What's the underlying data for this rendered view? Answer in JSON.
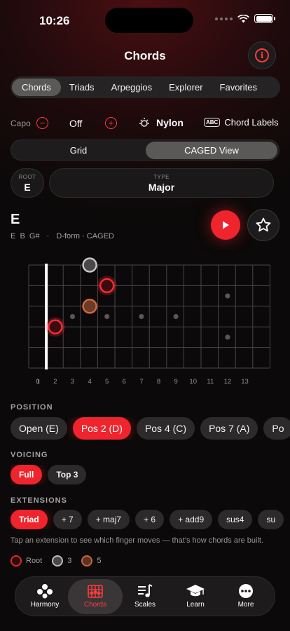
{
  "status": {
    "time": "10:26"
  },
  "header": {
    "title": "Chords"
  },
  "tabs": [
    {
      "label": "Chords"
    },
    {
      "label": "Triads"
    },
    {
      "label": "Arpeggios"
    },
    {
      "label": "Explorer"
    },
    {
      "label": "Favorites"
    }
  ],
  "capo": {
    "label": "Capo",
    "value": "Off",
    "minus_icon": "minus-circle-icon",
    "plus_icon": "plus-circle-icon"
  },
  "tone": {
    "label": "Nylon",
    "icon": "sun-icon"
  },
  "chord_labels": {
    "badge": "ABC",
    "label": "Chord Labels"
  },
  "view_toggle": {
    "grid": "Grid",
    "caged": "CAGED View",
    "selected": "CAGED View"
  },
  "root": {
    "caption": "ROOT",
    "value": "E"
  },
  "type": {
    "caption": "TYPE",
    "value": "Major"
  },
  "chord": {
    "name": "E",
    "notes": "E  B  G#",
    "sep": "·",
    "shape": "D-form · CAGED"
  },
  "fretboard": {
    "fret_numbers": [
      "0",
      "1",
      "2",
      "3",
      "4",
      "5",
      "6",
      "7",
      "8",
      "9",
      "10",
      "11",
      "12",
      "13"
    ],
    "inlays_single": [
      3,
      5,
      7,
      9
    ],
    "inlays_double": [
      12
    ],
    "notes": [
      {
        "string": 1,
        "fret": 4,
        "role": "third"
      },
      {
        "string": 2,
        "fret": 5,
        "role": "root"
      },
      {
        "string": 3,
        "fret": 4,
        "role": "fifth"
      },
      {
        "string": 4,
        "fret": 2,
        "role": "root"
      }
    ]
  },
  "position": {
    "label": "POSITION",
    "options": [
      {
        "label": "Open (E)",
        "active": false
      },
      {
        "label": "Pos 2 (D)",
        "active": true
      },
      {
        "label": "Pos 4 (C)",
        "active": false
      },
      {
        "label": "Pos 7 (A)",
        "active": false
      },
      {
        "label": "Po",
        "active": false
      }
    ]
  },
  "voicing": {
    "label": "VOICING",
    "options": [
      {
        "label": "Full",
        "active": true
      },
      {
        "label": "Top 3",
        "active": false
      }
    ]
  },
  "extensions": {
    "label": "EXTENSIONS",
    "options": [
      {
        "label": "Triad",
        "active": true
      },
      {
        "label": "+ 7",
        "active": false
      },
      {
        "label": "+ maj7",
        "active": false
      },
      {
        "label": "+ 6",
        "active": false
      },
      {
        "label": "+ add9",
        "active": false
      },
      {
        "label": "sus4",
        "active": false
      },
      {
        "label": "su",
        "active": false
      }
    ],
    "hint": "Tap an extension to see which finger moves — that's how chords are built."
  },
  "legend": [
    {
      "label": "Root",
      "color": "#e8232d"
    },
    {
      "label": "3",
      "color": "#9a9898"
    },
    {
      "label": "5",
      "color": "#c8643c"
    }
  ],
  "tabbar": [
    {
      "label": "Harmony",
      "icon": "harmony-icon"
    },
    {
      "label": "Chords",
      "icon": "chords-icon"
    },
    {
      "label": "Scales",
      "icon": "scales-icon"
    },
    {
      "label": "Learn",
      "icon": "graduation-cap-icon"
    },
    {
      "label": "More",
      "icon": "more-icon"
    }
  ],
  "colors": {
    "accent": "#f0242d",
    "root": "#e8232d",
    "third": "#9a9898",
    "fifth": "#c8643c"
  }
}
